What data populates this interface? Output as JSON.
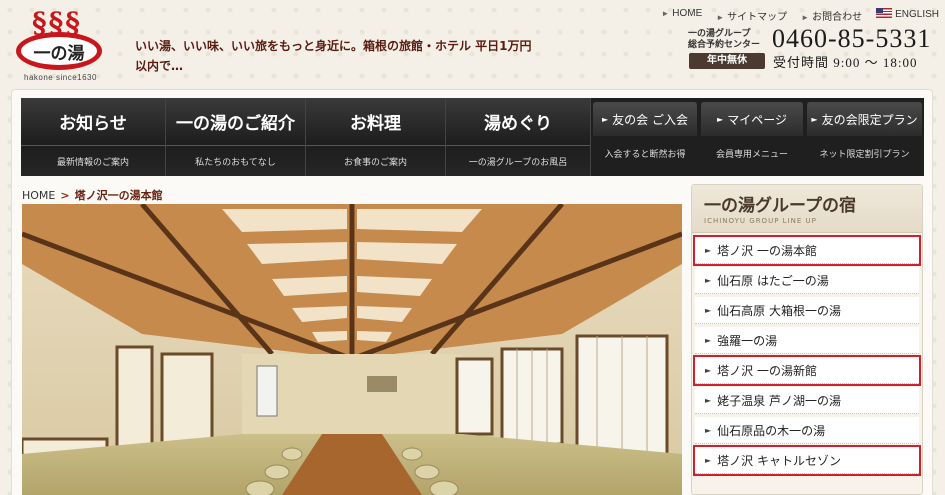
{
  "logo": {
    "steam": "§§§",
    "name": "一の湯",
    "sub": "hakone since1630"
  },
  "tagline": "いい湯、いい味、いい旅をもっと身近に。箱根の旅館・ホテル 平日1万円以内で…",
  "top_links": [
    {
      "label": "HOME"
    },
    {
      "label": "サイトマップ"
    },
    {
      "label": "お問合わせ"
    },
    {
      "label": "ENGLISH"
    }
  ],
  "contact": {
    "center_line1": "一の湯グループ",
    "center_line2": "総合予約センター",
    "phone": "0460-85-5331",
    "open_badge": "年中無休",
    "hours": "受付時間 9:00 〜 18:00"
  },
  "nav": {
    "main": [
      {
        "title": "お知らせ",
        "sub": "最新情報のご案内"
      },
      {
        "title": "一の湯のご紹介",
        "sub": "私たちのおもてなし"
      },
      {
        "title": "お料理",
        "sub": "お食事のご案内"
      },
      {
        "title": "湯めぐり",
        "sub": "一の湯グループのお風呂"
      }
    ],
    "small": [
      {
        "title": "友の会 ご入会",
        "sub": "入会すると断然お得"
      },
      {
        "title": "マイページ",
        "sub": "会員専用メニュー"
      },
      {
        "title": "友の会限定プラン",
        "sub": "ネット限定割引プラン"
      }
    ]
  },
  "breadcrumb": {
    "home": "HOME",
    "sep": ">",
    "current": "塔ノ沢一の湯本館"
  },
  "sidebar": {
    "title": "一の湯グループの宿",
    "subtitle": "ICHINOYU GROUP LINE UP",
    "items": [
      {
        "label": "塔ノ沢 一の湯本館",
        "highlight": true
      },
      {
        "label": "仙石原 はたご一の湯",
        "highlight": false
      },
      {
        "label": "仙石高原 大箱根一の湯",
        "highlight": false
      },
      {
        "label": "強羅一の湯",
        "highlight": false
      },
      {
        "label": "塔ノ沢 一の湯新館",
        "highlight": true
      },
      {
        "label": "姥子温泉 芦ノ湖一の湯",
        "highlight": false
      },
      {
        "label": "仙石原品の木一の湯",
        "highlight": false
      },
      {
        "label": "塔ノ沢 キャトルセゾン",
        "highlight": true
      }
    ]
  },
  "colors": {
    "accent_red": "#c8161d",
    "nav_bg": "#1f1f1f",
    "highlight_outline": "#d21f2b"
  }
}
